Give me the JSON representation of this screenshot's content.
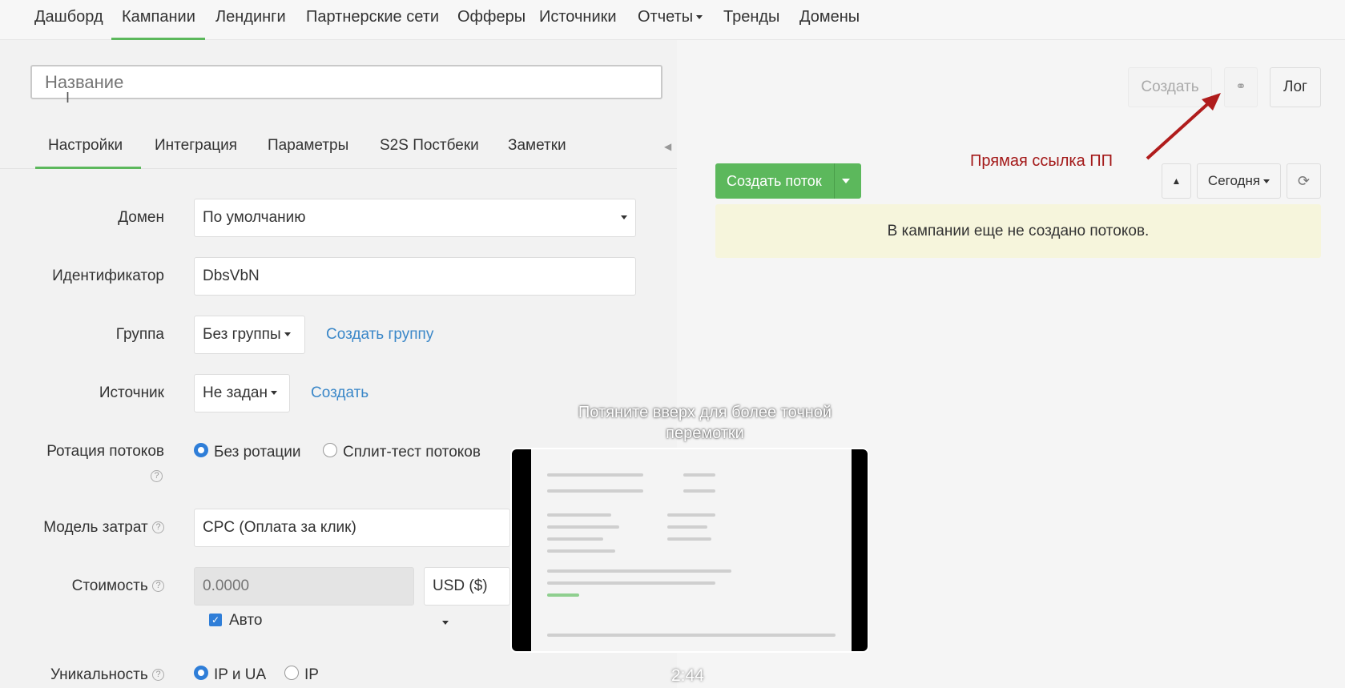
{
  "nav": {
    "items": [
      "Дашборд",
      "Кампании",
      "Лендинги",
      "Партнерские сети",
      "Офферы",
      "Источники",
      "Отчеты",
      "Тренды",
      "Домены"
    ],
    "active": "Кампании"
  },
  "name_input": {
    "placeholder": "Название"
  },
  "tabs": [
    "Настройки",
    "Интеграция",
    "Параметры",
    "S2S Постбеки",
    "Заметки"
  ],
  "form": {
    "domain": {
      "label": "Домен",
      "value": "По умолчанию"
    },
    "identifier": {
      "label": "Идентификатор",
      "value": "DbsVbN"
    },
    "group": {
      "label": "Группа",
      "value": "Без группы",
      "link": "Создать группу"
    },
    "source": {
      "label": "Источник",
      "value": "Не задан",
      "link": "Создать"
    },
    "rotation": {
      "label": "Ротация потоков",
      "opt1": "Без ротации",
      "opt2": "Сплит-тест потоков"
    },
    "cost_model": {
      "label": "Модель затрат",
      "value": "CPC (Оплата за клик)"
    },
    "cost": {
      "label": "Стоимость",
      "placeholder": "0.0000",
      "currency": "USD ($)",
      "auto": "Авто"
    },
    "uniqueness": {
      "label": "Уникальность",
      "opt1": "IP и UA",
      "opt2": "IP"
    }
  },
  "toolbar": {
    "create": "Создать",
    "log": "Лог",
    "link_icon": "link-icon"
  },
  "annotation": "Прямая ссылка ПП",
  "flows": {
    "create_flow": "Создать поток",
    "period": "Сегодня",
    "empty_message": "В кампании еще не создано потоков."
  },
  "video": {
    "hint": "Потяните вверх для более точной перемотки",
    "timecode": "2:44"
  },
  "colors": {
    "accent": "#5cb85c",
    "link": "#3a87c8",
    "annotation": "#a31818"
  }
}
